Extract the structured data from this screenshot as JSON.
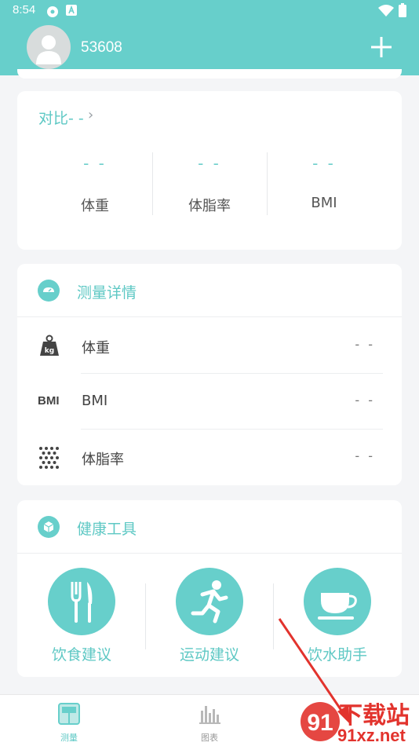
{
  "status_bar": {
    "time": "8:54"
  },
  "header": {
    "username": "53608"
  },
  "compare": {
    "title": "对比- -",
    "stats": [
      {
        "value": "- -",
        "label": "体重"
      },
      {
        "value": "- -",
        "label": "体脂率"
      },
      {
        "value": "- -",
        "label": "BMI"
      }
    ]
  },
  "details": {
    "title": "测量详情",
    "rows": [
      {
        "label": "体重",
        "value": "- -",
        "icon": "kg-weight-icon"
      },
      {
        "label": "BMI",
        "value": "- -",
        "icon": "bmi-icon",
        "icon_text": "BMI"
      },
      {
        "label": "体脂率",
        "value": "- -",
        "icon": "dots-grid-icon"
      }
    ]
  },
  "tools": {
    "title": "健康工具",
    "items": [
      {
        "label": "饮食建议",
        "icon": "fork-knife-icon"
      },
      {
        "label": "运动建议",
        "icon": "running-icon"
      },
      {
        "label": "饮水助手",
        "icon": "coffee-cup-icon"
      }
    ]
  },
  "tabs": [
    {
      "label": "测量",
      "icon": "scale-icon",
      "active": true
    },
    {
      "label": "图表",
      "icon": "bar-chart-icon",
      "active": false
    }
  ],
  "watermark": {
    "top": "下载站",
    "bottom": "91xz.net",
    "number": "91"
  },
  "colors": {
    "accent": "#67cfcb",
    "accent_text": "#5ec8c4",
    "watermark": "#e2332d"
  }
}
